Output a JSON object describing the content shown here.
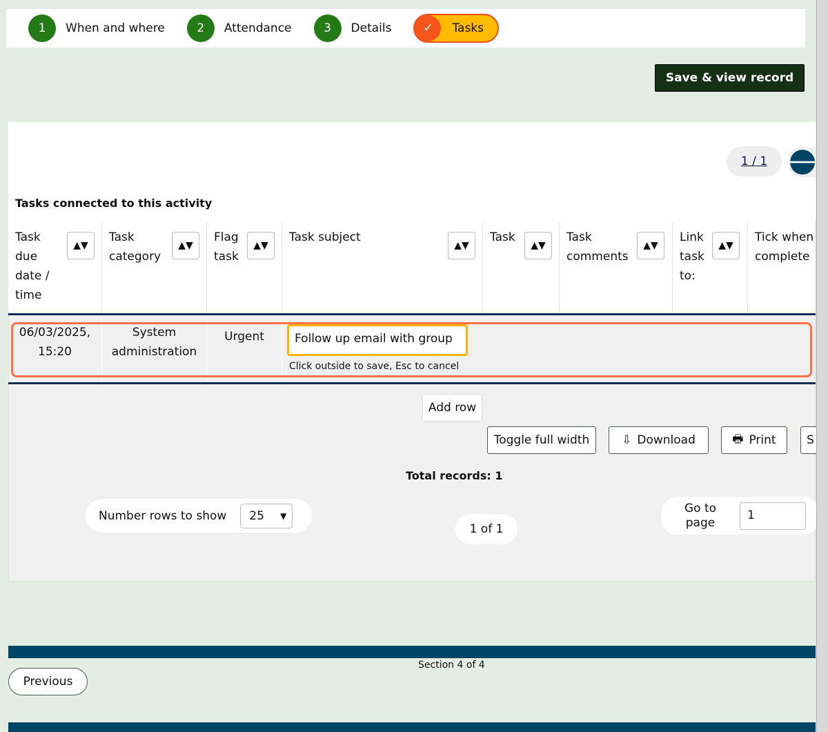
{
  "stepper": {
    "steps": [
      {
        "num": "1",
        "label": "When and where"
      },
      {
        "num": "2",
        "label": "Attendance"
      },
      {
        "num": "3",
        "label": "Details"
      },
      {
        "num": "✓",
        "label": "Tasks"
      }
    ]
  },
  "save_label": "Save & view record",
  "pager": "1 / 1",
  "caption": "Tasks connected to this activity",
  "sort_icon": "▲▼",
  "columns": [
    "Task due date / time",
    "Task category",
    "Flag task",
    "Task subject",
    "Task",
    "Task comments",
    "Link task to:",
    "Tick when complete"
  ],
  "row": {
    "due": "06/03/2025, 15:20",
    "category": "System administration",
    "flag": "Urgent",
    "subject": "Follow up email with group",
    "hint": "Click outside to save, Esc to cancel"
  },
  "buttons": {
    "add_row": "Add row",
    "toggle": "Toggle full width",
    "download": "Download",
    "print": "Print",
    "s": "S"
  },
  "total": "Total records: 1",
  "rows_label": "Number rows to show",
  "rows_value": "25",
  "page_of": "1 of 1",
  "goto_label": "Go to page",
  "goto_value": "1",
  "section": "Section 4 of 4",
  "previous": "Previous",
  "colors": {
    "step": "#237a16",
    "active": "#ffbb00",
    "accent": "#004466",
    "highlight": "#ff7043"
  }
}
